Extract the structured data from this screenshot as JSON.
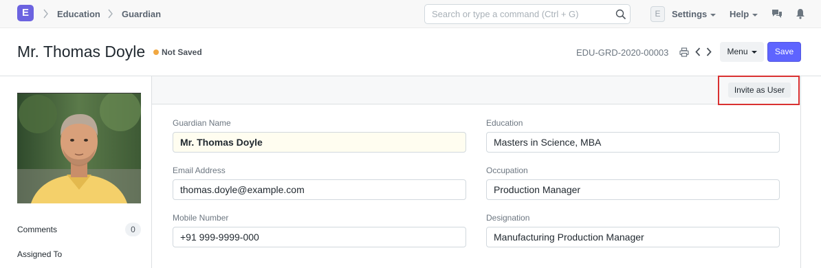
{
  "navbar": {
    "logo_letter": "E",
    "breadcrumbs": [
      "Education",
      "Guardian"
    ],
    "search_placeholder": "Search or type a command (Ctrl + G)",
    "avatar_letter": "E",
    "settings_label": "Settings",
    "help_label": "Help",
    "icons": [
      "search-icon",
      "chat-icon",
      "bell-icon"
    ]
  },
  "page_head": {
    "title": "Mr. Thomas Doyle",
    "status": "Not Saved",
    "status_color": "#f1a842",
    "doc_name": "EDU-GRD-2020-00003",
    "menu_label": "Menu",
    "save_label": "Save",
    "accent_color": "#5e64ff"
  },
  "sidebar": {
    "comments_label": "Comments",
    "comments_count": "0",
    "assigned_label": "Assigned To"
  },
  "form": {
    "invite_label": "Invite as User",
    "fields": [
      {
        "label": "Guardian Name",
        "value": "Mr. Thomas Doyle"
      },
      {
        "label": "Education",
        "value": "Masters in Science, MBA"
      },
      {
        "label": "Email Address",
        "value": "thomas.doyle@example.com"
      },
      {
        "label": "Occupation",
        "value": "Production Manager"
      },
      {
        "label": "Mobile Number",
        "value": "+91 999-9999-000"
      },
      {
        "label": "Designation",
        "value": "Manufacturing Production Manager"
      }
    ]
  }
}
